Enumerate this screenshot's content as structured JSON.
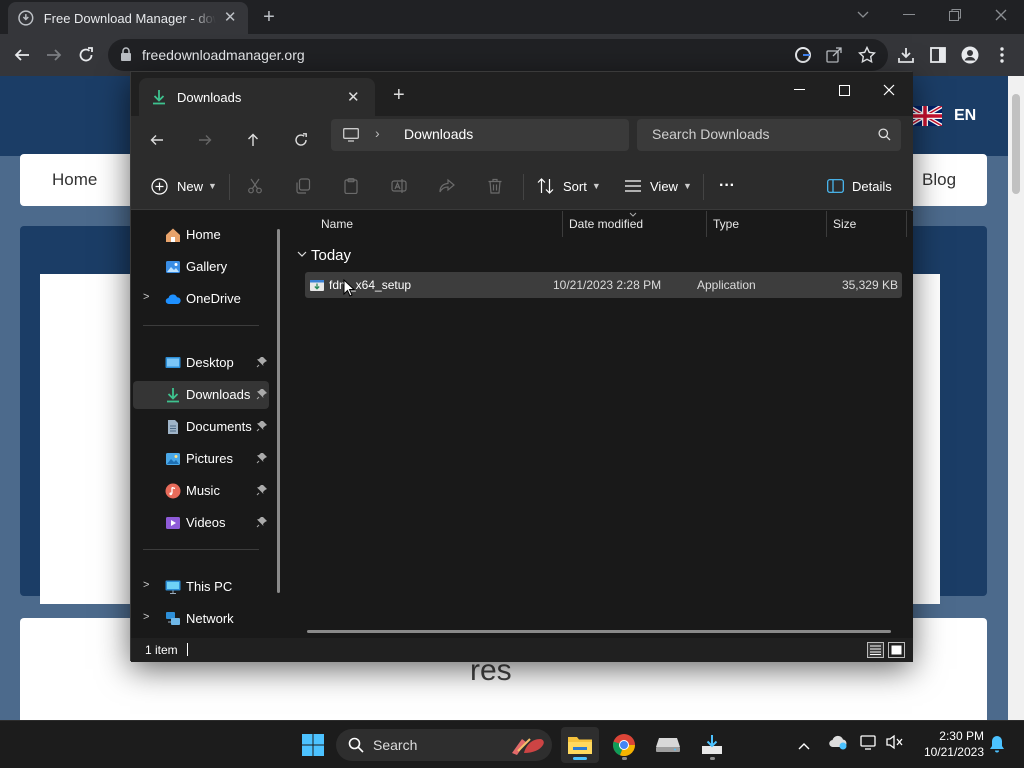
{
  "browser": {
    "tab_title": "Free Download Manager - download",
    "url": "freedownloadmanager.org"
  },
  "website": {
    "lang": "EN",
    "nav_home": "Home",
    "nav_blog": "Blog",
    "features_partial": "res"
  },
  "explorer": {
    "tab_label": "Downloads",
    "breadcrumb": "Downloads",
    "search_placeholder": "Search Downloads",
    "commands": {
      "new": "New",
      "sort": "Sort",
      "view": "View",
      "more": "···",
      "details": "Details"
    },
    "sidebar": {
      "home": "Home",
      "gallery": "Gallery",
      "onedrive": "OneDrive",
      "desktop": "Desktop",
      "downloads": "Downloads",
      "documents": "Documents",
      "pictures": "Pictures",
      "music": "Music",
      "videos": "Videos",
      "thispc": "This PC",
      "network": "Network"
    },
    "columns": {
      "name": "Name",
      "date": "Date modified",
      "type": "Type",
      "size": "Size"
    },
    "group": "Today",
    "file": {
      "name": "fdm_x64_setup",
      "date": "10/21/2023 2:28 PM",
      "type": "Application",
      "size": "35,329 KB"
    },
    "status": "1 item"
  },
  "taskbar": {
    "search": "Search",
    "time": "2:30 PM",
    "date": "10/21/2023"
  },
  "colors": {
    "accent": "#4cc2ff",
    "download_green": "#3ec28f",
    "site_header": "#1b3d66"
  }
}
